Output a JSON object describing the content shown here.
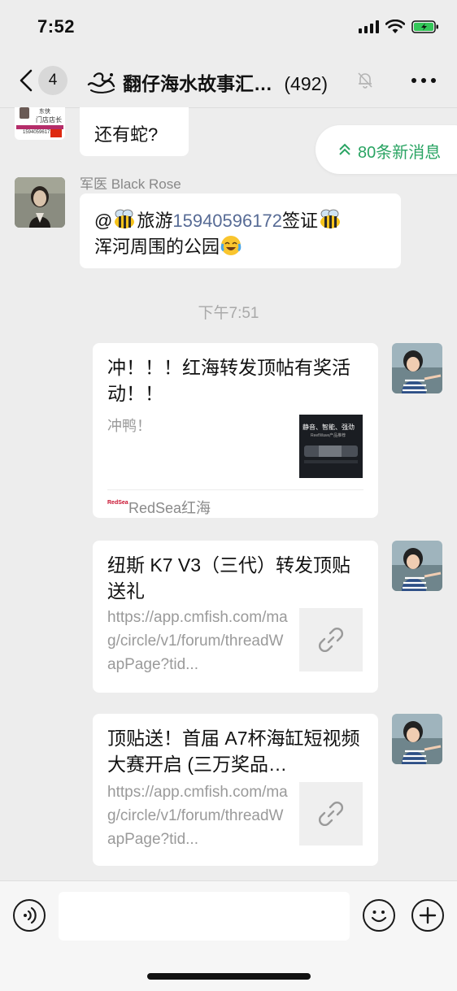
{
  "status_bar": {
    "time": "7:52"
  },
  "nav": {
    "back_badge": "4",
    "title": "翻仔海水故事汇…",
    "count": "(492)"
  },
  "new_messages_pill": {
    "label": "80条新消息"
  },
  "messages": [
    {
      "type": "text",
      "avatar_lines": [
        "东侠",
        "门店店长",
        "15940596172"
      ],
      "text": "还有蛇?"
    },
    {
      "type": "text",
      "sender": "军医 Black Rose",
      "line1_prefix": "@",
      "line1_mid": "旅游",
      "line1_phone": "15940596172",
      "line1_suffix": "签证",
      "line2": "浑河周围的公园"
    }
  ],
  "time_separator": "下午7:51",
  "cards": [
    {
      "title": "冲！！！红海转发顶帖有奖活动！！",
      "description": "冲鸭！",
      "thumb_text_top": "静音、智能、强劲",
      "thumb_text_sub": "ReefWave产品推荐",
      "source_logo": "RedSea",
      "source_name": "RedSea红海"
    },
    {
      "title": "纽斯 K7 V3（三代）转发顶贴送礼",
      "url": "https://app.cmfish.com/mag/circle/v1/forum/threadWapPage?tid..."
    },
    {
      "title": "顶贴送！首届 A7杯海缸短视频大赛开启 (三万奖品…",
      "url": "https://app.cmfish.com/mag/circle/v1/forum/threadWapPage?tid..."
    }
  ],
  "input": {
    "placeholder": ""
  },
  "icons": {
    "back": "chevron-left-icon",
    "group": "group-chat-icon",
    "mute": "bell-off-icon",
    "more": "more-dots-icon",
    "voice": "voice-icon",
    "emoji": "emoji-icon",
    "add": "plus-icon",
    "link": "link-icon"
  },
  "colors": {
    "accent_green": "#2aa463",
    "link_blue": "#576b95",
    "background": "#ededed"
  }
}
